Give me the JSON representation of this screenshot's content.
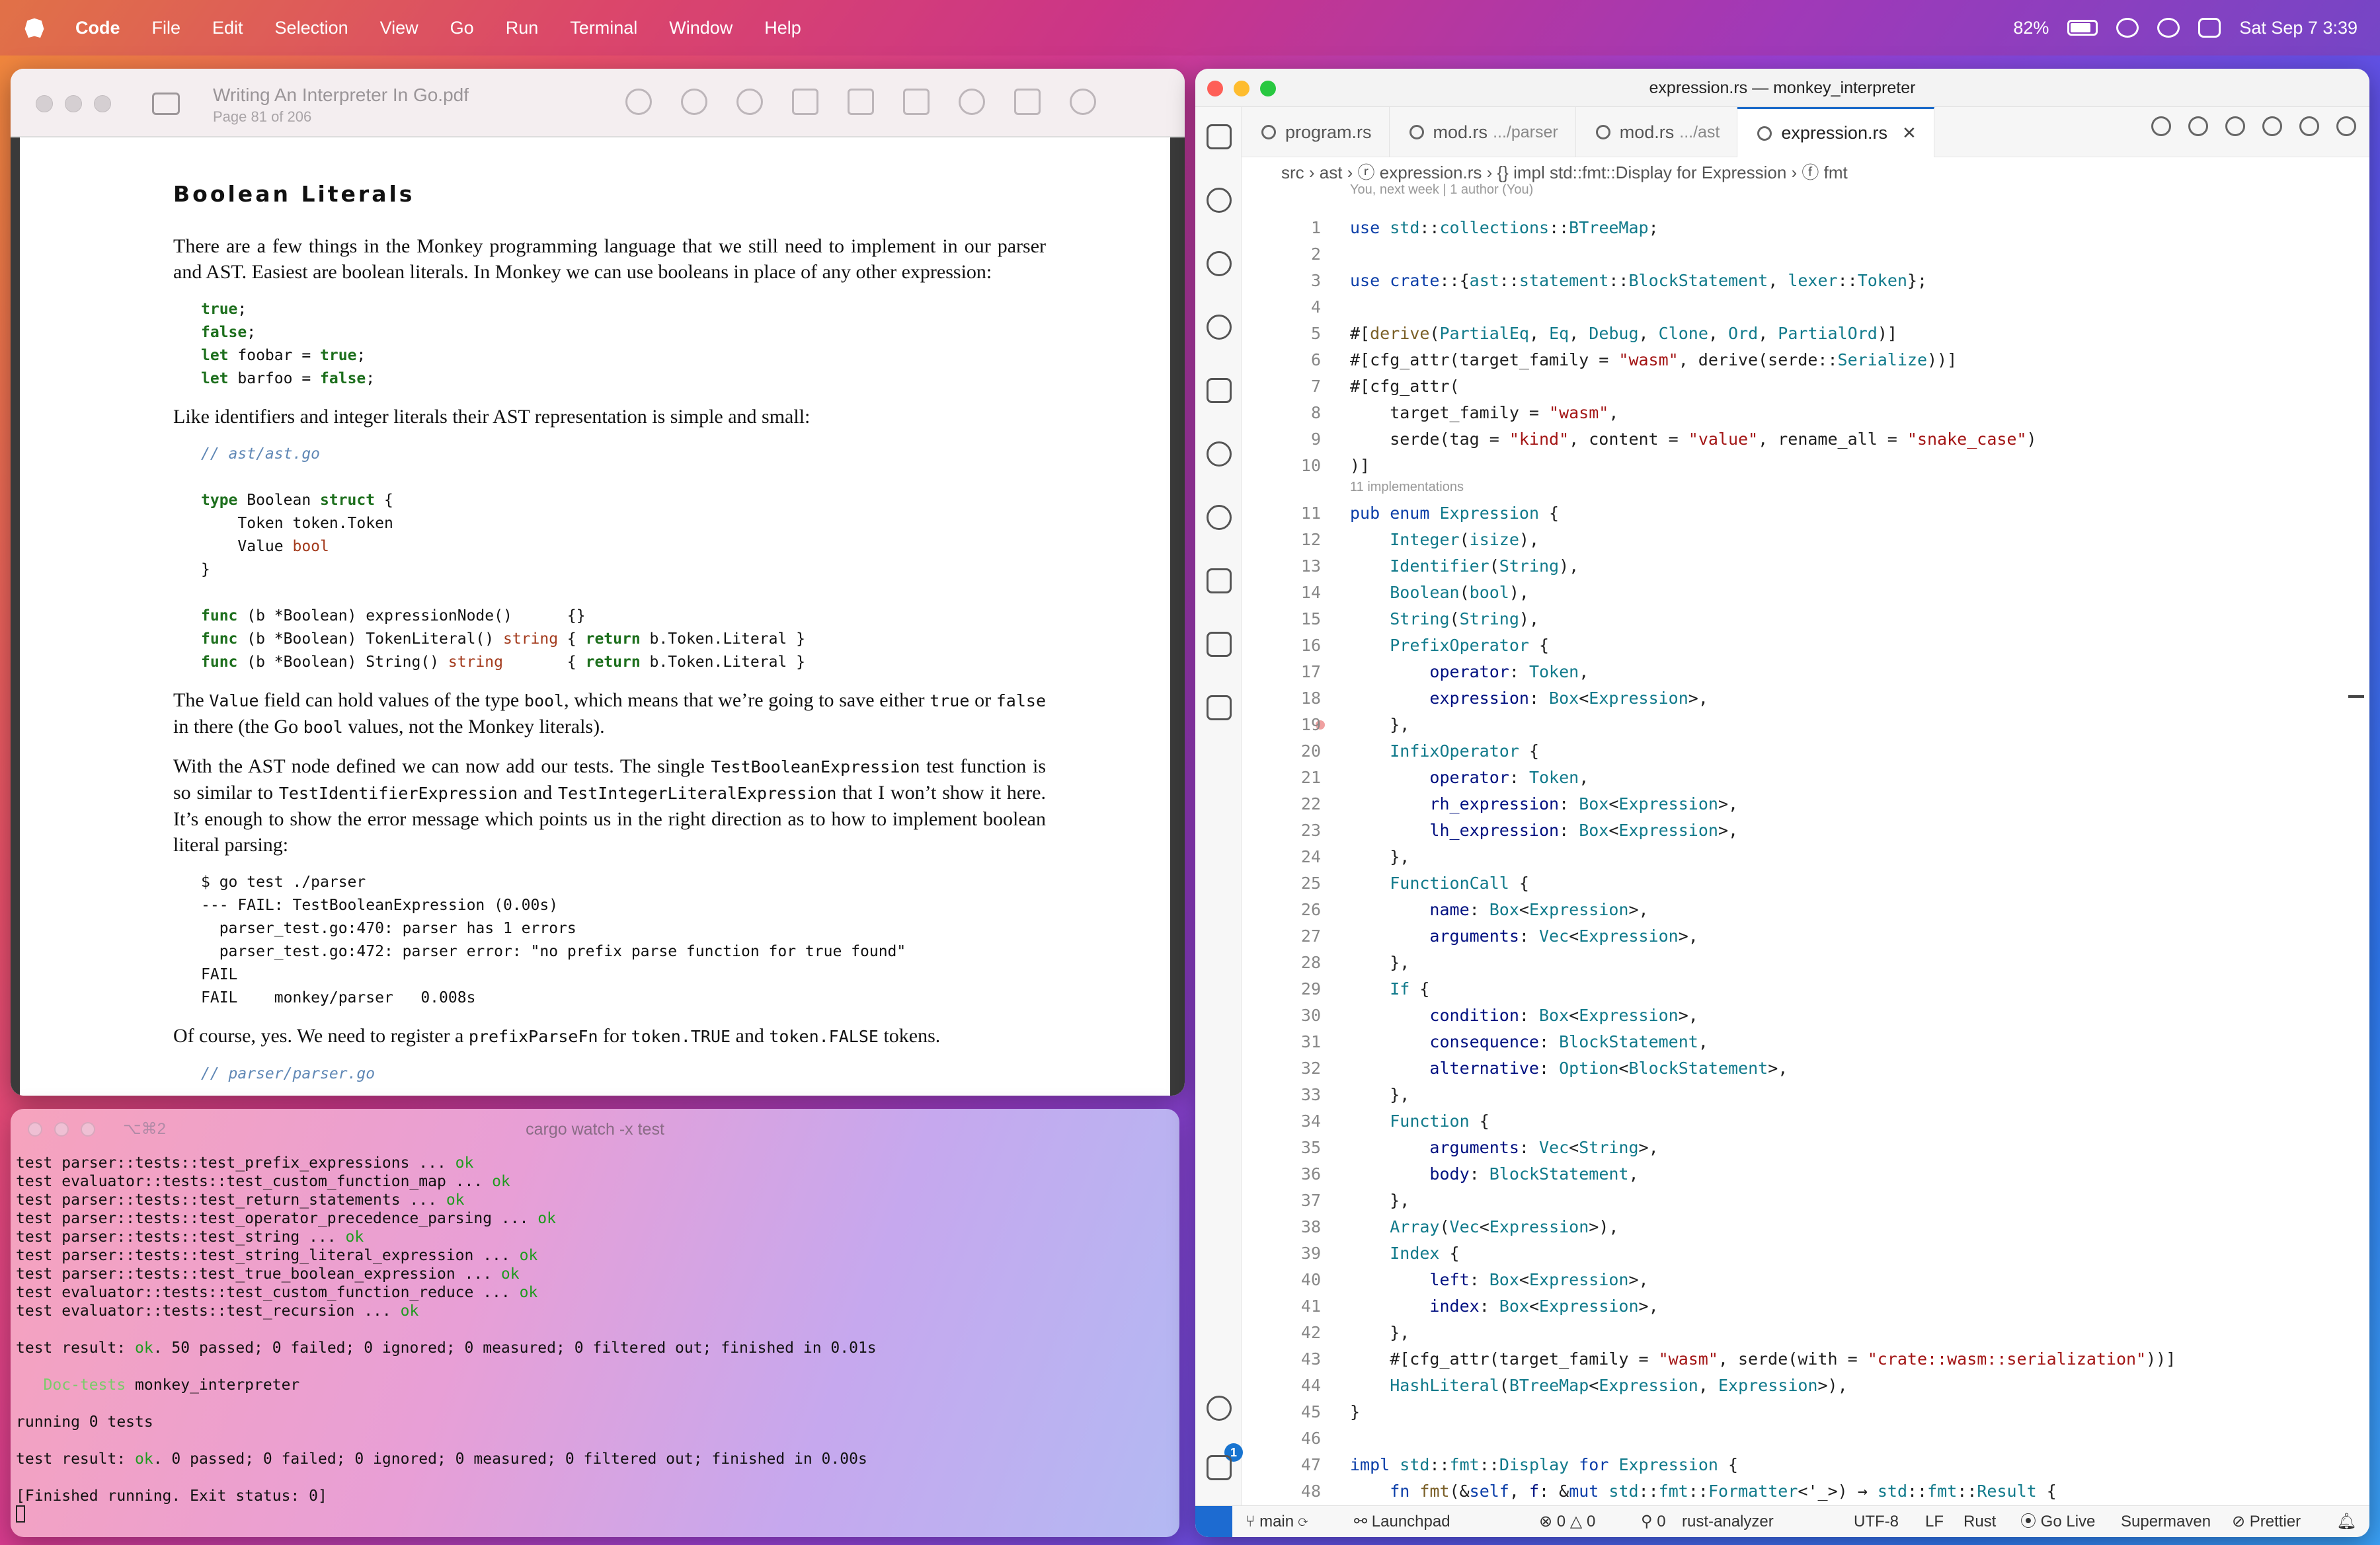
{
  "menubar": {
    "app": "Code",
    "items": [
      "File",
      "Edit",
      "Selection",
      "View",
      "Go",
      "Run",
      "Terminal",
      "Window",
      "Help"
    ],
    "battery": "82%",
    "datetime": "Sat Sep 7  3:39"
  },
  "pdf": {
    "title": "Writing An Interpreter In Go.pdf",
    "subtitle": "Page 81 of 206",
    "heading": "Boolean Literals",
    "p1": "There are a few things in the Monkey programming language that we still need to implement in our parser and AST. Easiest are boolean literals. In Monkey we can use booleans in place of any other expression:",
    "p2": "Like identifiers and integer literals their AST representation is simple and small:",
    "p3_a": "The ",
    "p3_b": "Value",
    "p3_c": " field can hold values of the type ",
    "p3_d": "bool",
    "p3_e": ", which means that we’re going to save either ",
    "p3_f": "true",
    "p3_g": " or ",
    "p3_h": "false",
    "p3_i": " in there (the Go ",
    "p3_j": "bool",
    "p3_k": " values, not the Monkey literals).",
    "p4_a": "With the AST node defined we can now add our tests. The single ",
    "p4_b": "TestBooleanExpression",
    "p4_c": " test function is so similar to ",
    "p4_d": "TestIdentifierExpression",
    "p4_e": " and ",
    "p4_f": "TestIntegerLiteralExpression",
    "p4_g": " that I won’t show it here. It’s enough to show the error message which points us in the right direction as to how to implement boolean literal parsing:",
    "test_output": "$ go test ./parser\n--- FAIL: TestBooleanExpression (0.00s)\n  parser_test.go:470: parser has 1 errors\n  parser_test.go:472: parser error: \"no prefix parse function for true found\"\nFAIL\nFAIL    monkey/parser   0.008s",
    "p5_a": "Of course, yes. We need to register a ",
    "p5_b": "prefixParseFn",
    "p5_c": " for ",
    "p5_d": "token.TRUE",
    "p5_e": " and ",
    "p5_f": "token.FALSE",
    "p5_g": " tokens.",
    "cut_comment": "// parser/parser.go"
  },
  "terminal": {
    "shortcut": "⌥⌘2",
    "title": "cargo watch -x test",
    "tests": [
      "test parser::tests::test_prefix_expressions ... ",
      "test evaluator::tests::test_custom_function_map ... ",
      "test parser::tests::test_return_statements ... ",
      "test parser::tests::test_operator_precedence_parsing ... ",
      "test parser::tests::test_string ... ",
      "test parser::tests::test_string_literal_expression ... ",
      "test parser::tests::test_true_boolean_expression ... ",
      "test evaluator::tests::test_custom_function_reduce ... ",
      "test evaluator::tests::test_recursion ... "
    ],
    "ok": "ok",
    "result1_a": "test result: ",
    "result1_b": ". 50 passed; 0 failed; 0 ignored; 0 measured; 0 filtered out; finished in 0.01s",
    "doc_label": "Doc-tests",
    "doc_crate": " monkey_interpreter",
    "running": "running 0 tests",
    "result2_b": ". 0 passed; 0 failed; 0 ignored; 0 measured; 0 filtered out; finished in 0.00s",
    "finished": "[Finished running. Exit status: 0]"
  },
  "vscode": {
    "title": "expression.rs — monkey_interpreter",
    "tabs": [
      {
        "name": "program.rs",
        "dim": ""
      },
      {
        "name": "mod.rs",
        "dim": ".../parser"
      },
      {
        "name": "mod.rs",
        "dim": ".../ast"
      },
      {
        "name": "expression.rs",
        "dim": ""
      }
    ],
    "breadcrumb": "src  ›  ast  ›  ⓡ expression.rs  ›  {} impl std::fmt::Display for Expression  ›  ⓕ fmt",
    "blame": "You, next week | 1 author (You)",
    "impl_hint": "11 implementations",
    "status": {
      "branch": "main",
      "launchpad": "Launchpad",
      "errors": "0",
      "warnings": "0",
      "ports": "0",
      "analyzer": "rust-analyzer",
      "encoding": "UTF-8",
      "eol": "LF",
      "lang": "Rust",
      "golive": "Go Live",
      "supermaven": "Supermaven",
      "prettier": "Prettier"
    },
    "badge": "1"
  }
}
